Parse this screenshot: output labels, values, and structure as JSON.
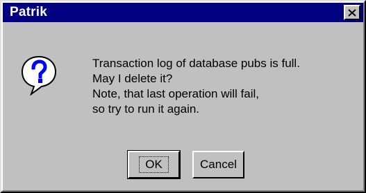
{
  "window": {
    "title": "Patrik"
  },
  "dialog": {
    "icon": "question-icon",
    "message_lines": [
      "Transaction log of database pubs is full.",
      "May I delete it?",
      "Note, that last operation will fail,",
      "so try to run it again."
    ],
    "buttons": {
      "ok": "OK",
      "cancel": "Cancel"
    }
  },
  "colors": {
    "titlebar": "#000080",
    "face": "#c0c0c0",
    "icon_blue": "#0000ff"
  }
}
